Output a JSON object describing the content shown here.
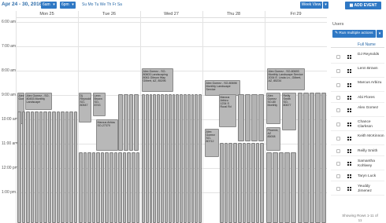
{
  "toolbar": {
    "date_range": "Apr 24 - 30, 2016",
    "start_time": "6am",
    "end_time": "6pm",
    "caret": "▾",
    "days_filter": "Su Mo Tu We Th Fr Sa",
    "view": "Week View",
    "add_event": "ADD EVENT"
  },
  "calendar": {
    "days": [
      "Mon 25",
      "Tue 26",
      "Wed 27",
      "Thu 28",
      "Fri 29"
    ],
    "times": [
      "6:00 am",
      "7:00 am",
      "8:00 am",
      "9:00 am",
      "10:00 am",
      "11:00 am",
      "12:00 pm",
      "1:00 pm"
    ],
    "events": {
      "wed_main": "Alex Gomez - SO-80603 Landscaping 8061 Gibson Way Gilbert, AZ, 85296",
      "thu_main": "Alex Gomez - SO-80698 Monthly Landscape Service",
      "fri_main": "Alex Gomez - SO-80693 Monthly Landscape Service 2034 E. Linda Ln., Gilbert, AZ, 85234",
      "mon_a": "Alex Gomez - SO-80453 Monthly Landscape",
      "mon_b": "Alex Gomez",
      "tue_a": "Dj Reynolds SO-80547",
      "tue_b": "Lenn Brown SO-8743",
      "tue_c": "Marcus Arbizu SO-27370",
      "thu_a": "Marcus Arbizu 1234 S Rural Rd",
      "thu_b": "Alex Gomez SO-80712",
      "fri_a": "Alex Gomez SO-80 Monthly",
      "fri_b": "Reilly Smith SO-80677",
      "fri_c": "Phoenix, AZ 85008"
    }
  },
  "users_panel": {
    "title": "Users",
    "run_button": "Run multiple actions",
    "caret": "▾",
    "column_header": "Full Name",
    "users": [
      "DJ Reynolds",
      "Lenn Brown",
      "Marcus Arbizu",
      "Abi Flores",
      "Alex Gomez",
      "Chance Clarkson",
      "Keith McKinnon",
      "Reilly Smith",
      "Samantha Kohlwey",
      "Taryn Luck",
      "Yeuddy Jimenez"
    ],
    "showing": "Showing Rows 1-11 of 11"
  },
  "colors": {
    "accent": "#2f78c4",
    "event_fill": "#b8b8b8"
  }
}
